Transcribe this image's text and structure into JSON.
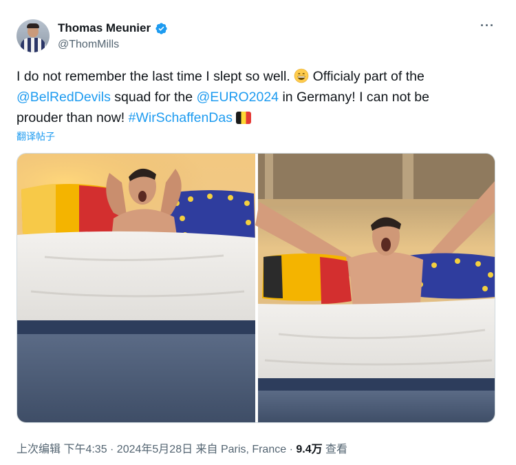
{
  "author": {
    "name": "Thomas Meunier",
    "handle": "@ThomMills"
  },
  "tweet": {
    "line1_a": "I do not remember the last time I slept so well. ",
    "line1_b": " Officialy part of the",
    "mention1": "@BelRedDevils",
    "line2_a": " squad for the ",
    "mention2": "@EURO2024",
    "line2_b": " in Germany!  I can not be",
    "line3_a": "prouder than now! ",
    "hashtag": "#WirSchaffenDas",
    "translate_label": "翻译帖子"
  },
  "media": {
    "images": [
      "photo-left",
      "photo-right"
    ]
  },
  "meta": {
    "prefix": "上次编辑 下午4:35 · 2024年5月28日 来自 Paris, France · ",
    "views_count": "9.4万",
    "views_label": " 查看"
  },
  "colors": {
    "link": "#1d9bf0",
    "muted": "#536471",
    "verified": "#1d9bf0"
  },
  "icons": {
    "verified": "verified-badge-icon",
    "more": "more-icon",
    "grin": "grinning-face-emoji",
    "flag": "belgium-flag-emoji"
  }
}
